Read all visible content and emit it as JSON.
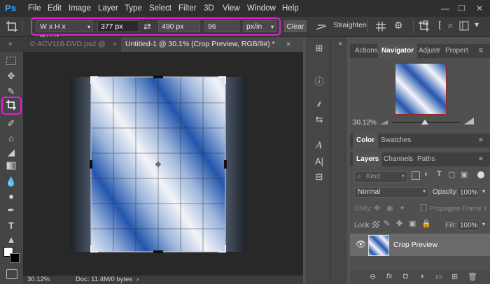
{
  "app": {
    "logo": "Ps"
  },
  "menu": [
    "File",
    "Edit",
    "Image",
    "Layer",
    "Type",
    "Select",
    "Filter",
    "3D",
    "View",
    "Window",
    "Help"
  ],
  "window_controls": {
    "minimize": "—",
    "maximize": "☐",
    "close": "✕"
  },
  "options": {
    "preset": "W x H x Resol…",
    "width": "377 px",
    "swap": "⇄",
    "height": "490 px",
    "resolution": "96",
    "unit": "px/in",
    "clear": "Clear",
    "straighten": "Straighten"
  },
  "tabs": {
    "inactive": "© ACV118-DVD.psd @",
    "active": "Untitled-1 @ 30.1% (Crop Preview, RGB/8#) *",
    "close": "×"
  },
  "status": {
    "zoom": "30.12%",
    "doc": "Doc: 11.4M/0 bytes",
    "arrow": "›"
  },
  "navigator": {
    "tabs": [
      "Actions",
      "Navigator",
      "Adjustr",
      "Propert"
    ],
    "active": "Navigator",
    "zoom": "30.12%"
  },
  "color_panel": {
    "tabs": [
      "Color",
      "Swatches"
    ],
    "active": "Color"
  },
  "layers_panel": {
    "tabs": [
      "Layers",
      "Channels",
      "Paths"
    ],
    "active": "Layers",
    "kind": "Kind",
    "blend_mode": "Normal",
    "opacity_label": "Opacity:",
    "opacity": "100%",
    "unify_label": "Unify:",
    "propagate": "Propagate Frame 1",
    "lock_label": "Lock:",
    "fill_label": "Fill:",
    "fill": "100%",
    "layer_name": "Crop Preview"
  },
  "colors": {
    "highlight": "#e01fd0",
    "accent": "#31a8ff"
  }
}
